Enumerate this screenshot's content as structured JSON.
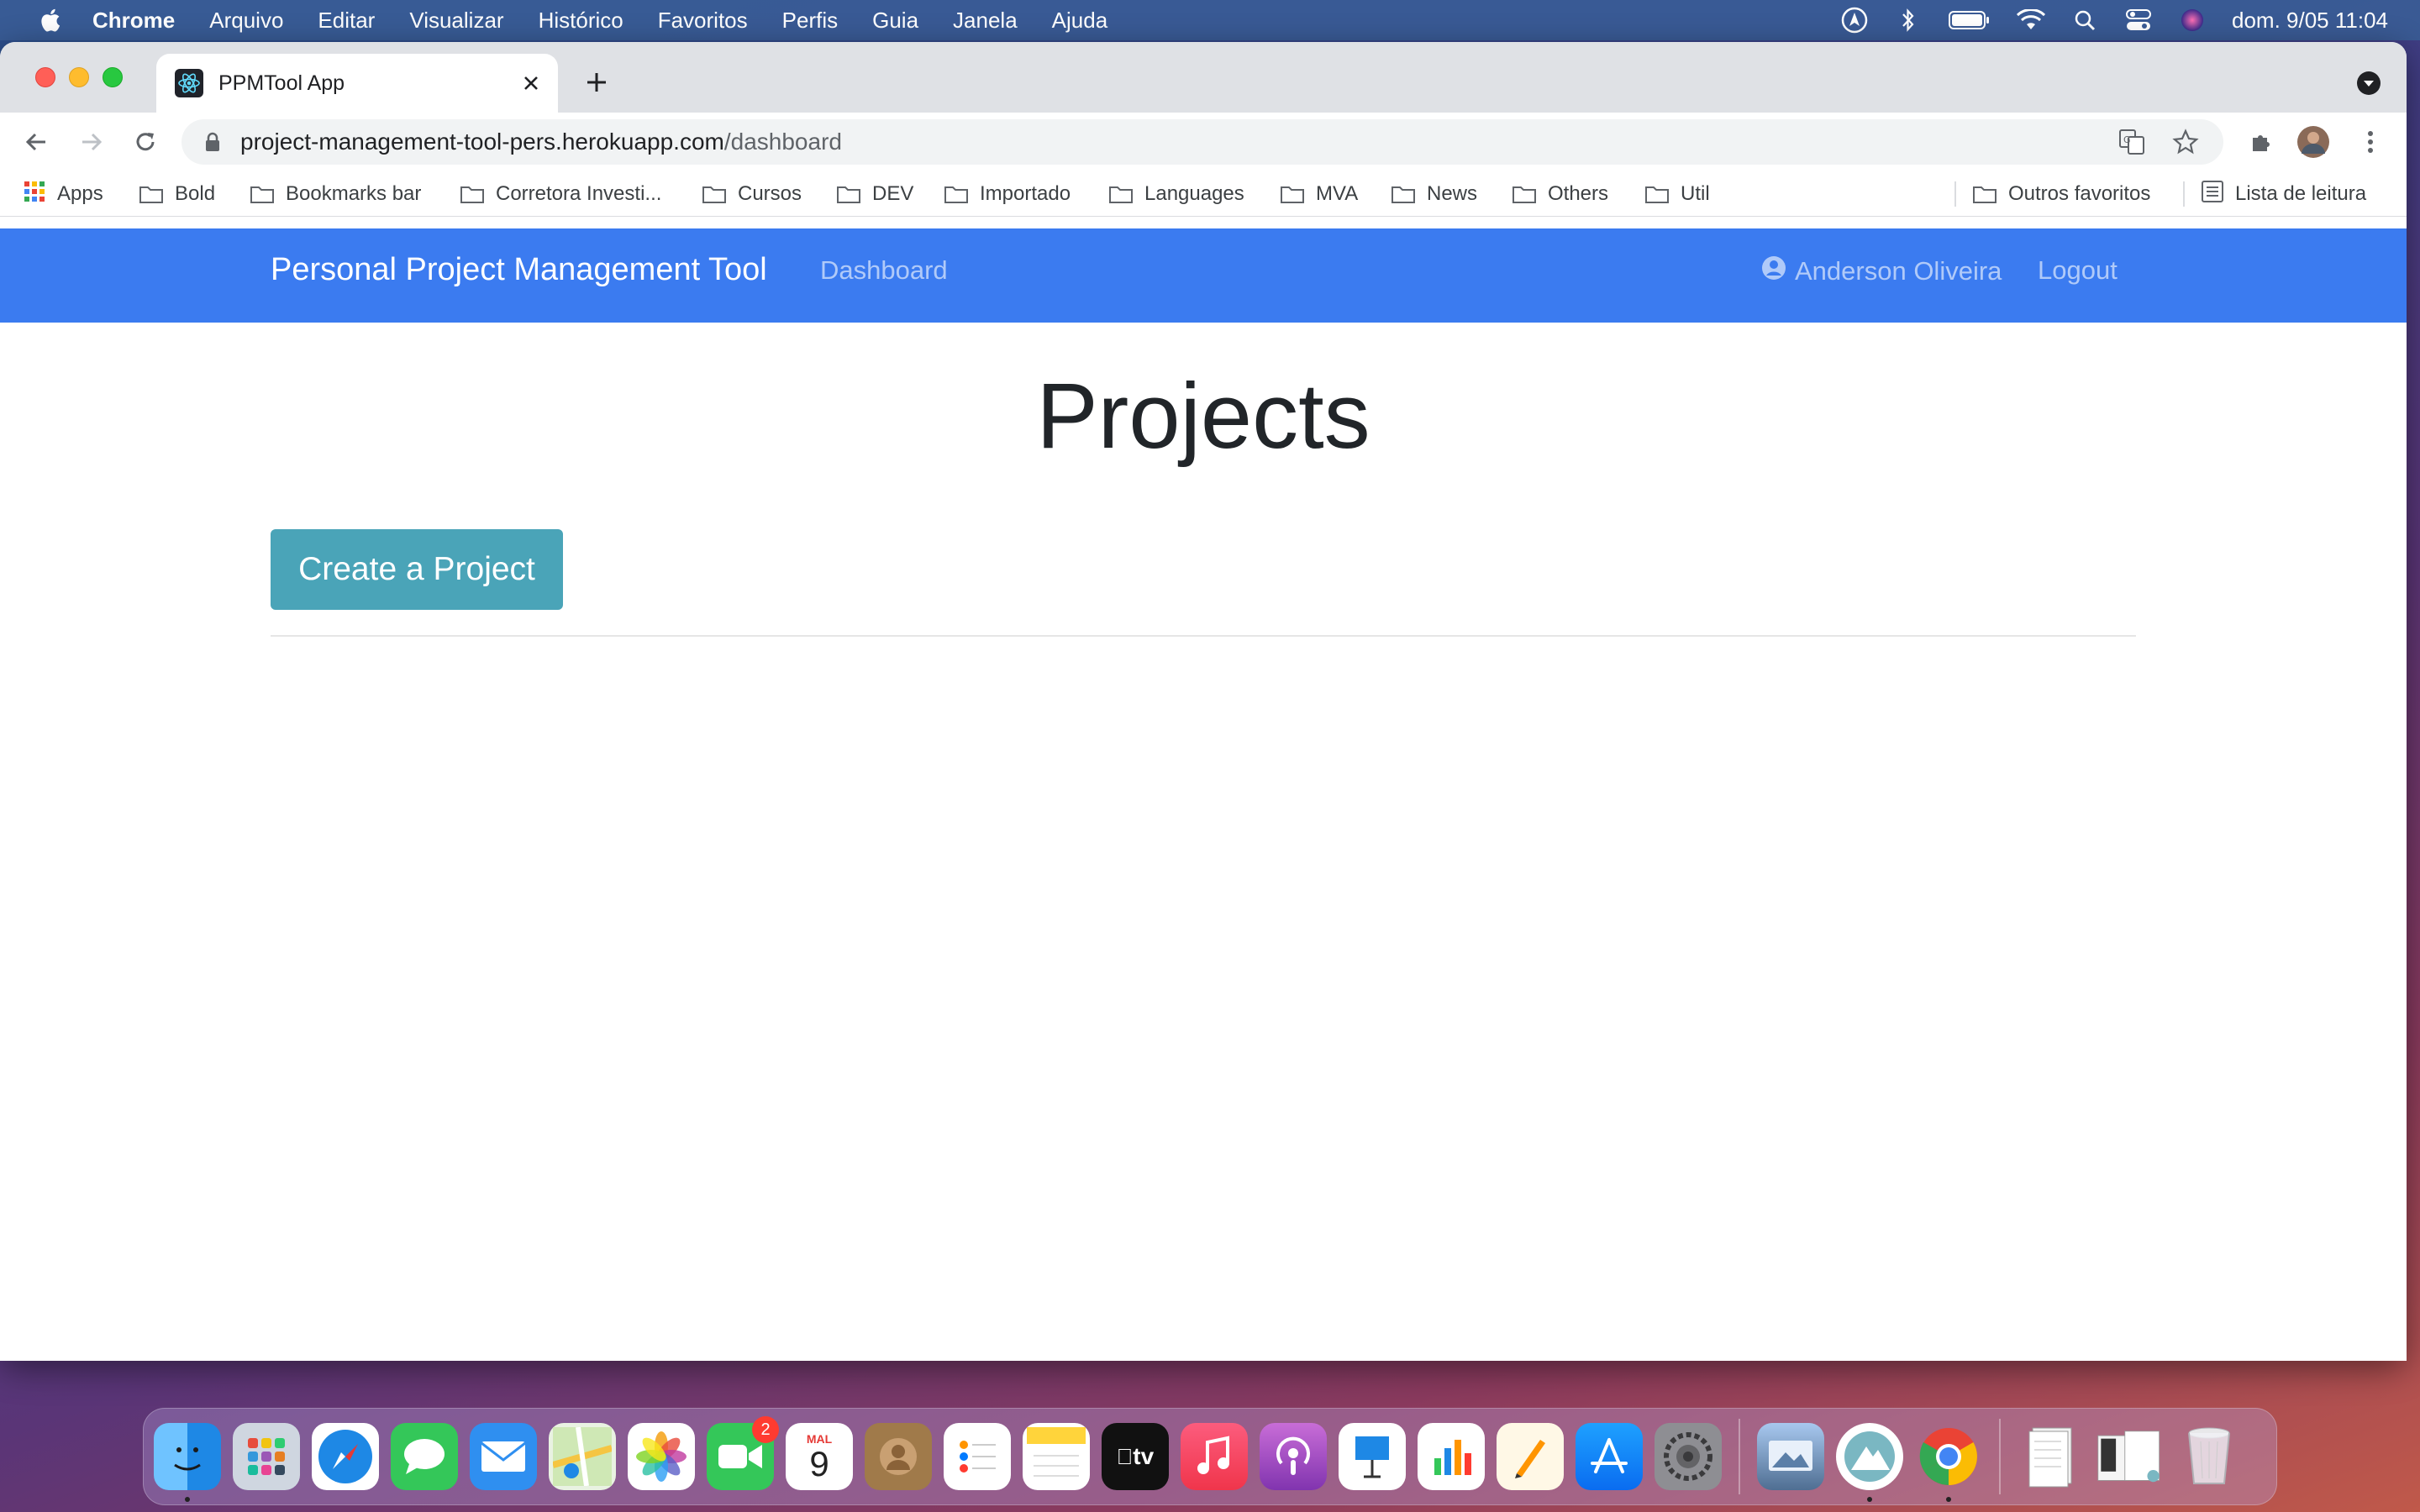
{
  "menubar": {
    "app_name": "Chrome",
    "items": [
      "Arquivo",
      "Editar",
      "Visualizar",
      "Histórico",
      "Favoritos",
      "Perfis",
      "Guia",
      "Janela",
      "Ajuda"
    ],
    "clock": "dom. 9/05  11:04"
  },
  "browser": {
    "tab_title": "PPMTool App",
    "url_host": "project-management-tool-pers.herokuapp.com",
    "url_path": "/dashboard",
    "bookmarks": [
      "Apps",
      "Bold",
      "Bookmarks bar",
      "Corretora Investi...",
      "Cursos",
      "DEV",
      "Importado",
      "Languages",
      "MVA",
      "News",
      "Others",
      "Util"
    ],
    "other_bookmarks": "Outros favoritos",
    "reading_list": "Lista de leitura"
  },
  "app": {
    "brand": "Personal Project Management Tool",
    "nav_dashboard": "Dashboard",
    "user_name": "Anderson Oliveira",
    "logout": "Logout",
    "page_title": "Projects",
    "create_button": "Create a Project"
  },
  "dock": {
    "calendar_month": "MAL",
    "calendar_day": "9",
    "facetime_badge": "2",
    "tv_label": "tv"
  },
  "colors": {
    "navbar": "#3b7bf0",
    "create_button": "#4aa4b8"
  }
}
